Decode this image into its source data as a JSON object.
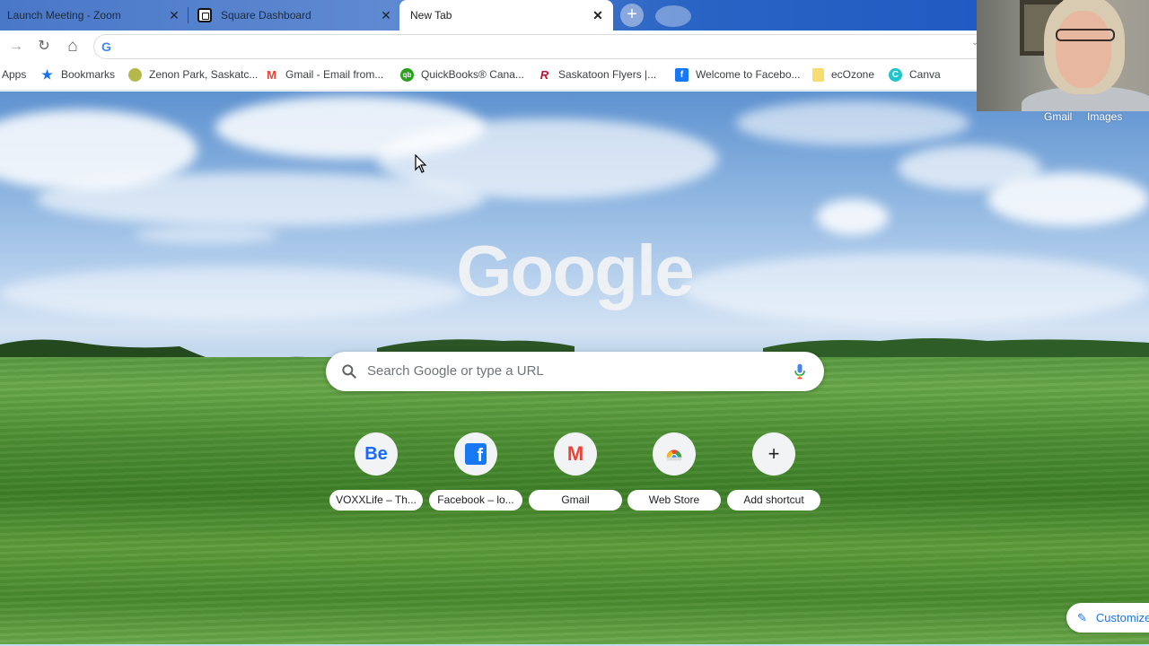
{
  "tabs": [
    {
      "title": "Launch Meeting - Zoom",
      "active": false
    },
    {
      "title": "Square Dashboard",
      "active": false
    },
    {
      "title": "New Tab",
      "active": true
    }
  ],
  "tab_close_glyph": "✕",
  "new_tab_glyph": "+",
  "toolbar": {
    "back_icon": "→",
    "reload_icon": "↻",
    "home_icon": "⌂",
    "omnibox_value": "",
    "omnibox_icon": "G"
  },
  "bookmarks": [
    {
      "label": "Apps",
      "icon": "apps-icon"
    },
    {
      "label": "Bookmarks",
      "icon": "star-icon"
    },
    {
      "label": "Zenon Park, Saskatc...",
      "icon": "zenon-park-icon"
    },
    {
      "label": "Gmail - Email from...",
      "icon": "gmail-icon"
    },
    {
      "label": "QuickBooks® Cana...",
      "icon": "quickbooks-icon"
    },
    {
      "label": "Saskatoon Flyers |...",
      "icon": "saskatoon-flyers-icon"
    },
    {
      "label": "Welcome to Facebo...",
      "icon": "facebook-icon"
    },
    {
      "label": "ecOzone",
      "icon": "folder-icon"
    },
    {
      "label": "Canva",
      "icon": "canva-icon"
    }
  ],
  "top_links": {
    "gmail": "Gmail",
    "images": "Images"
  },
  "logo_text": "Google",
  "search": {
    "placeholder": "Search Google or type a URL"
  },
  "shortcuts": [
    {
      "label": "VOXXLife – Th...",
      "icon": "behance-icon",
      "glyph": "Be"
    },
    {
      "label": "Facebook – lo...",
      "icon": "facebook-icon",
      "glyph": "f"
    },
    {
      "label": "Gmail",
      "icon": "gmail-icon",
      "glyph": "M"
    },
    {
      "label": "Web Store",
      "icon": "chrome-web-store-icon",
      "glyph": ""
    },
    {
      "label": "Add shortcut",
      "icon": "plus-icon",
      "glyph": "+"
    }
  ],
  "customize": {
    "label": "Customize"
  },
  "colors": {
    "accent_blue": "#1a73e8",
    "tabstrip": "#4a78c8",
    "facebook": "#1877f2",
    "gmail_red": "#ea4335",
    "behance": "#1769ff"
  }
}
